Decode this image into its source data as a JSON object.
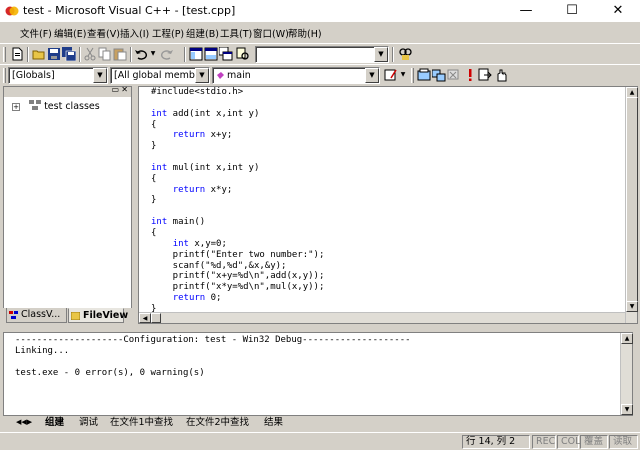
{
  "window": {
    "title": "test - Microsoft Visual C++ - [test.cpp]",
    "minimize": "—",
    "maximize": "☐",
    "close": "✕"
  },
  "menu": [
    "文件(F)",
    "编辑(E)",
    "查看(V)",
    "插入(I)",
    "工程(P)",
    "组建(B)",
    "工具(T)",
    "窗口(W)",
    "帮助(H)"
  ],
  "wizardbar": {
    "scope": "[Globals]",
    "members": "[All global members",
    "function": "main"
  },
  "workspace": {
    "tree_root": "test classes",
    "tabs": [
      "ClassV...",
      "FileView"
    ]
  },
  "editor": {
    "code": [
      {
        "pre": "#include<stdio.h>",
        "kw": "",
        "post": ""
      },
      {
        "pre": "",
        "kw": "",
        "post": ""
      },
      {
        "pre": "",
        "kw": "int",
        "post": " add(int x,int y)"
      },
      {
        "pre": "{",
        "kw": "",
        "post": ""
      },
      {
        "pre": "    ",
        "kw": "return",
        "post": " x+y;"
      },
      {
        "pre": "}",
        "kw": "",
        "post": ""
      },
      {
        "pre": "",
        "kw": "",
        "post": ""
      },
      {
        "pre": "",
        "kw": "int",
        "post": " mul(int x,int y)"
      },
      {
        "pre": "{",
        "kw": "",
        "post": ""
      },
      {
        "pre": "    ",
        "kw": "return",
        "post": " x*y;"
      },
      {
        "pre": "}",
        "kw": "",
        "post": ""
      },
      {
        "pre": "",
        "kw": "",
        "post": ""
      },
      {
        "pre": "",
        "kw": "int",
        "post": " main()"
      },
      {
        "pre": "{",
        "kw": "",
        "post": ""
      },
      {
        "pre": "    ",
        "kw": "int",
        "post": " x,y=0;"
      },
      {
        "pre": "    printf(\"Enter two number:\");",
        "kw": "",
        "post": ""
      },
      {
        "pre": "    scanf(\"%d,%d\",&x,&y);",
        "kw": "",
        "post": ""
      },
      {
        "pre": "    printf(\"x+y=%d\\n\",add(x,y));",
        "kw": "",
        "post": ""
      },
      {
        "pre": "    printf(\"x*y=%d\\n\",mul(x,y));",
        "kw": "",
        "post": ""
      },
      {
        "pre": "    ",
        "kw": "return",
        "post": " 0;"
      },
      {
        "pre": "}",
        "kw": "",
        "post": ""
      }
    ]
  },
  "output": {
    "lines": [
      "--------------------Configuration: test - Win32 Debug--------------------",
      "Linking...",
      "",
      "test.exe - 0 error(s), 0 warning(s)"
    ],
    "tabs": [
      "组建",
      "调试",
      "在文件1中查找",
      "在文件2中查找",
      "结果"
    ]
  },
  "status": {
    "position": "行 14, 列 2",
    "rec": "REC",
    "col": "COL",
    "ovr": "覆盖",
    "read": "读取"
  },
  "icons": [
    "app-logo-icon",
    "new-file-icon",
    "open-icon",
    "save-icon",
    "save-all-icon",
    "cut-icon",
    "copy-icon",
    "paste-icon",
    "undo-icon",
    "redo-icon",
    "workspace-icon",
    "output-icon",
    "windows-icon",
    "find-in-files-icon",
    "find-icon",
    "class-wizard-icon",
    "compile-icon",
    "build-icon",
    "stop-build-icon",
    "execute-icon",
    "breakpoint-icon",
    "go-icon"
  ]
}
